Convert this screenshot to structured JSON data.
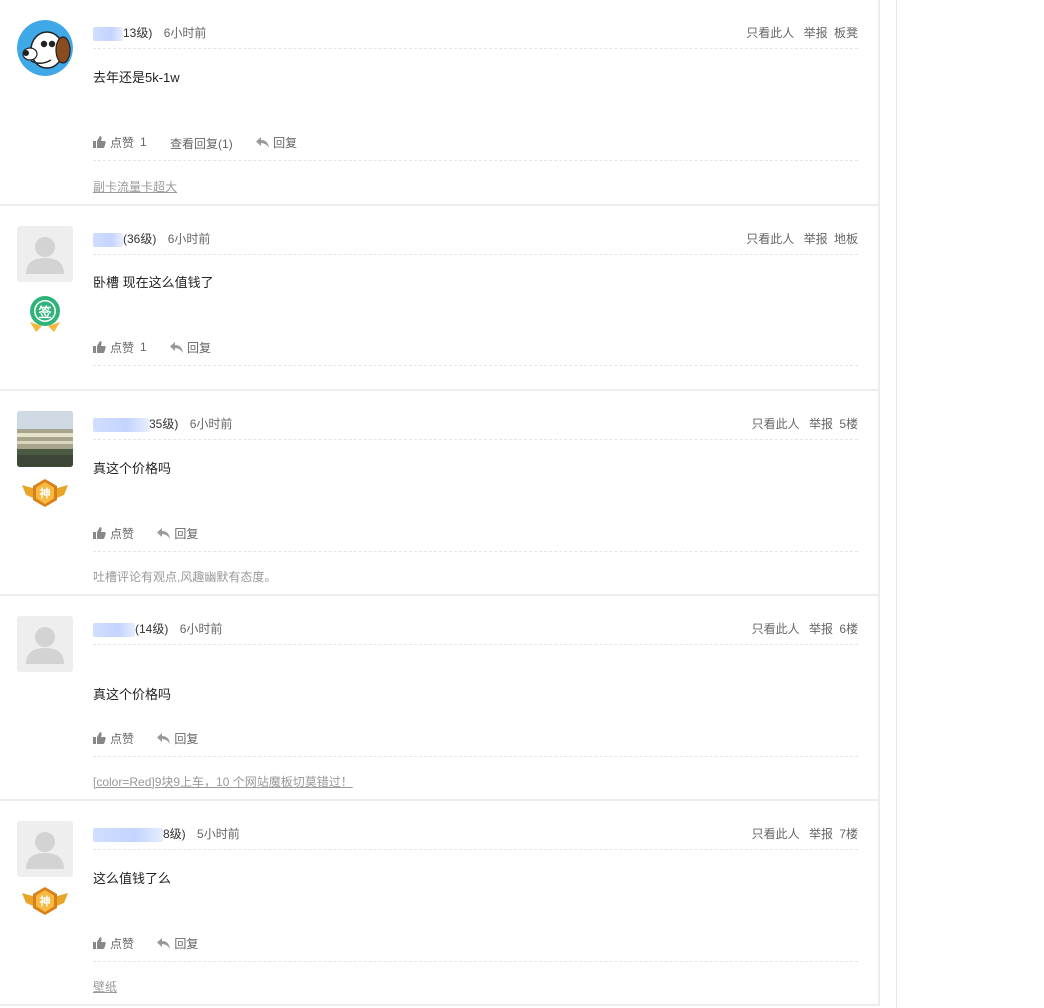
{
  "posts": [
    {
      "user_level": "13级)",
      "time": "6小时前",
      "op_only": "只看此人",
      "op_report": "举报",
      "floor": "板凳",
      "text": "去年还是5k-1w",
      "like_label": "点赞",
      "like_count": "1",
      "view_replies": "查看回复(1)",
      "reply_label": "回复",
      "signature": "副卡流量卡超大"
    },
    {
      "user_level": "(36级)",
      "time": "6小时前",
      "op_only": "只看此人",
      "op_report": "举报",
      "floor": "地板",
      "text": "卧槽 现在这么值钱了",
      "like_label": "点赞",
      "like_count": "1",
      "reply_label": "回复",
      "medal": "签"
    },
    {
      "user_level": "35级)",
      "time": "6小时前",
      "op_only": "只看此人",
      "op_report": "举报",
      "floor": "5楼",
      "text": "真这个价格吗",
      "like_label": "点赞",
      "reply_label": "回复",
      "signature": "吐槽评论有观点,风趣幽默有态度。",
      "medal": "神"
    },
    {
      "user_level": "(14级)",
      "time": "6小时前",
      "op_only": "只看此人",
      "op_report": "举报",
      "floor": "6楼",
      "text": "真这个价格吗",
      "like_label": "点赞",
      "reply_label": "回复",
      "signature": "[color=Red]9块9上车，10 个网站魔板切莫错过！"
    },
    {
      "user_level": "8级)",
      "time": "5小时前",
      "op_only": "只看此人",
      "op_report": "举报",
      "floor": "7楼",
      "text": "这么值钱了么",
      "like_label": "点赞",
      "reply_label": "回复",
      "signature": "壁纸",
      "medal": "神"
    }
  ]
}
